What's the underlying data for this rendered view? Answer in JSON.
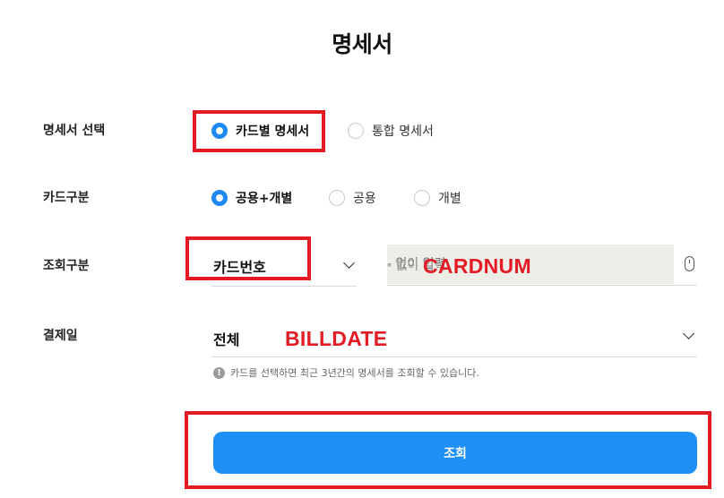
{
  "page_title": "명세서",
  "statement_select": {
    "label": "명세서 선택",
    "options": [
      {
        "label": "카드별 명세서",
        "selected": true
      },
      {
        "label": "통합 명세서",
        "selected": false
      }
    ]
  },
  "card_type": {
    "label": "카드구분",
    "options": [
      {
        "label": "공용+개별",
        "selected": true
      },
      {
        "label": "공용",
        "selected": false
      },
      {
        "label": "개별",
        "selected": false
      }
    ]
  },
  "query_type": {
    "label": "조회구분",
    "selected_value": "카드번호",
    "input_value": "- 없이 입력",
    "input_placeholder": "- 없이 입력",
    "annotation": "CARDNUM",
    "icon": "mouse-icon"
  },
  "billing_date": {
    "label": "결제일",
    "selected_value": "전체",
    "annotation": "BILLDATE"
  },
  "notice": {
    "icon": "info-icon",
    "text": "카드를 선택하면 최근 3년간의 명세서를 조회할 수 있습니다."
  },
  "submit": {
    "label": "조회"
  },
  "colors": {
    "accent": "#1e90f5",
    "highlight": "#e21b25"
  }
}
